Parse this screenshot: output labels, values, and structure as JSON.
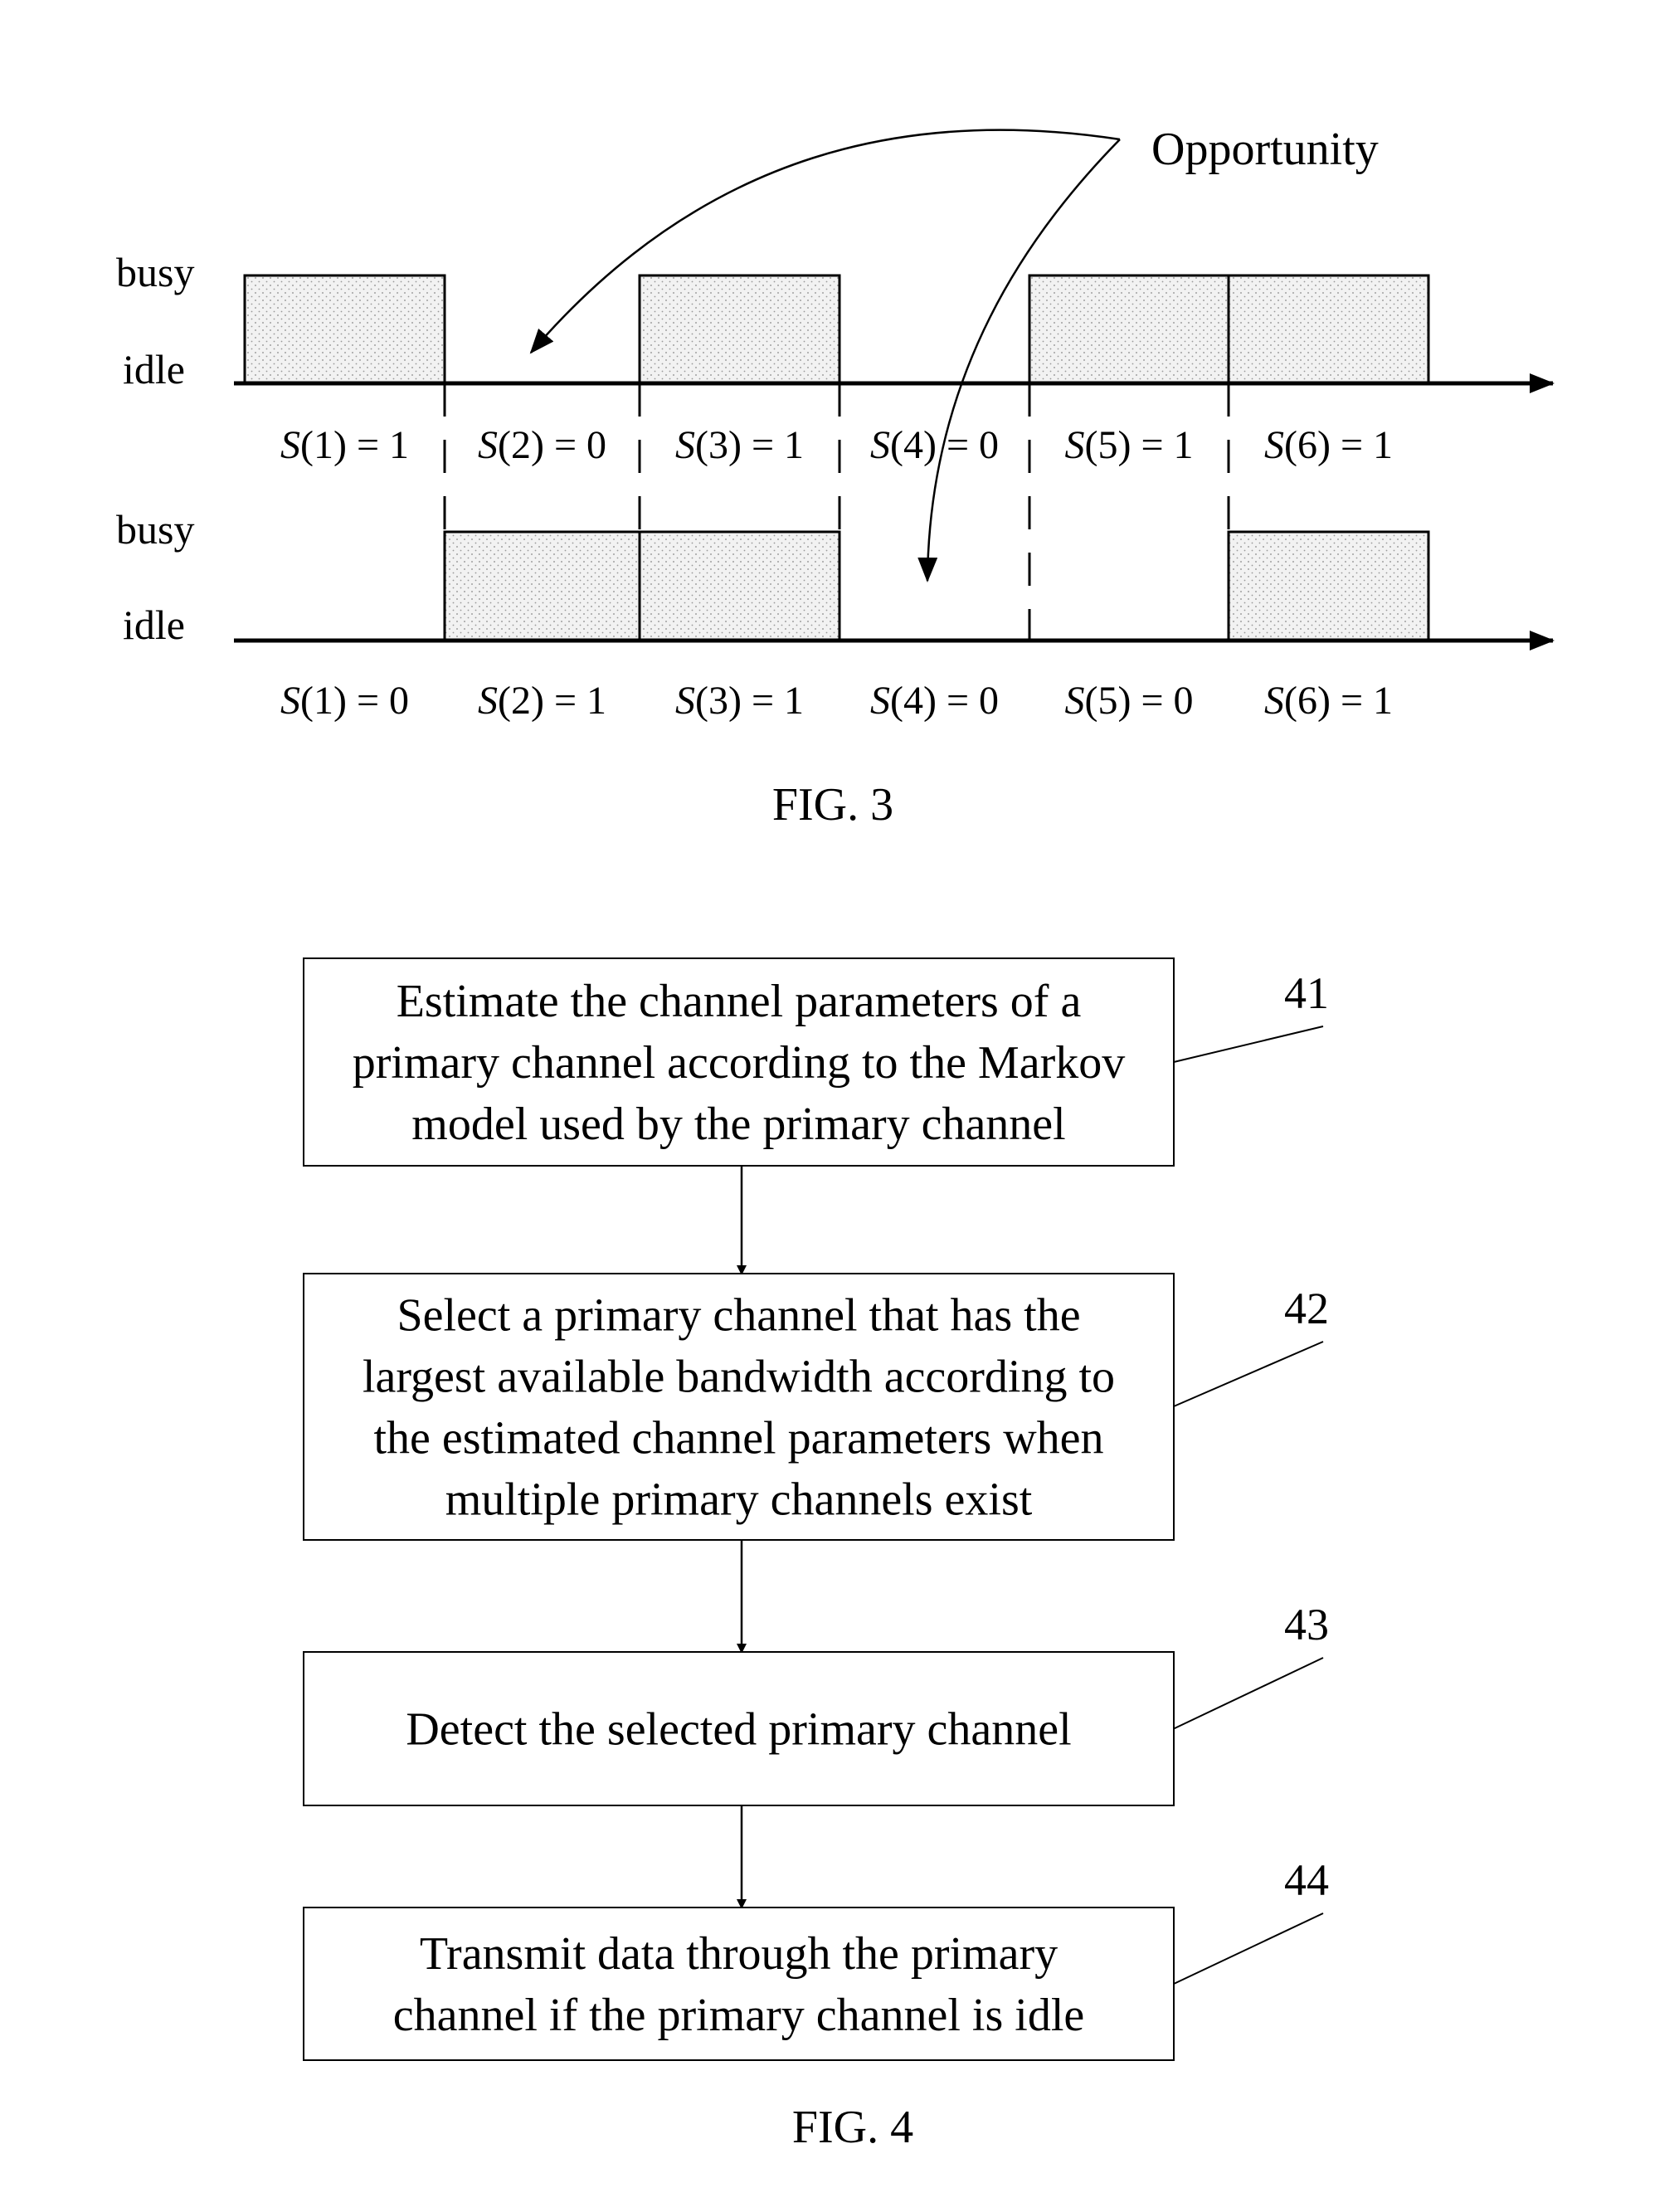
{
  "fig3": {
    "caption": "FIG. 3",
    "annotation": "Opportunity",
    "state_labels": {
      "busy": "busy",
      "idle": "idle"
    },
    "channels": [
      {
        "name": "top-channel",
        "slots": [
          {
            "label": "S(1) = 1",
            "index": "1",
            "value": "1"
          },
          {
            "label": "S(2) = 0",
            "index": "2",
            "value": "0"
          },
          {
            "label": "S(3) = 1",
            "index": "3",
            "value": "1"
          },
          {
            "label": "S(4) = 0",
            "index": "4",
            "value": "0"
          },
          {
            "label": "S(5) = 1",
            "index": "5",
            "value": "1"
          },
          {
            "label": "S(6) = 1",
            "index": "6",
            "value": "1"
          }
        ]
      },
      {
        "name": "bottom-channel",
        "slots": [
          {
            "label": "S(1) = 0",
            "index": "1",
            "value": "0"
          },
          {
            "label": "S(2) = 1",
            "index": "2",
            "value": "1"
          },
          {
            "label": "S(3) = 1",
            "index": "3",
            "value": "1"
          },
          {
            "label": "S(4) = 0",
            "index": "4",
            "value": "0"
          },
          {
            "label": "S(5) = 0",
            "index": "5",
            "value": "0"
          },
          {
            "label": "S(6) = 1",
            "index": "6",
            "value": "1"
          }
        ]
      }
    ]
  },
  "fig4": {
    "caption": "FIG. 4",
    "steps": [
      {
        "number": "41",
        "lines": [
          "Estimate the channel parameters of a",
          "primary channel according to the Markov",
          "model used by the primary channel"
        ]
      },
      {
        "number": "42",
        "lines": [
          "Select a primary channel that has the",
          "largest available bandwidth according to",
          "the estimated channel parameters when",
          "multiple primary channels exist"
        ]
      },
      {
        "number": "43",
        "lines": [
          "Detect the selected primary channel"
        ]
      },
      {
        "number": "44",
        "lines": [
          "Transmit data through the primary",
          "channel if the primary channel is idle"
        ]
      }
    ]
  },
  "colors": {
    "stroke": "#000000",
    "fill_busy": "#e6e6e6",
    "background": "#ffffff"
  }
}
